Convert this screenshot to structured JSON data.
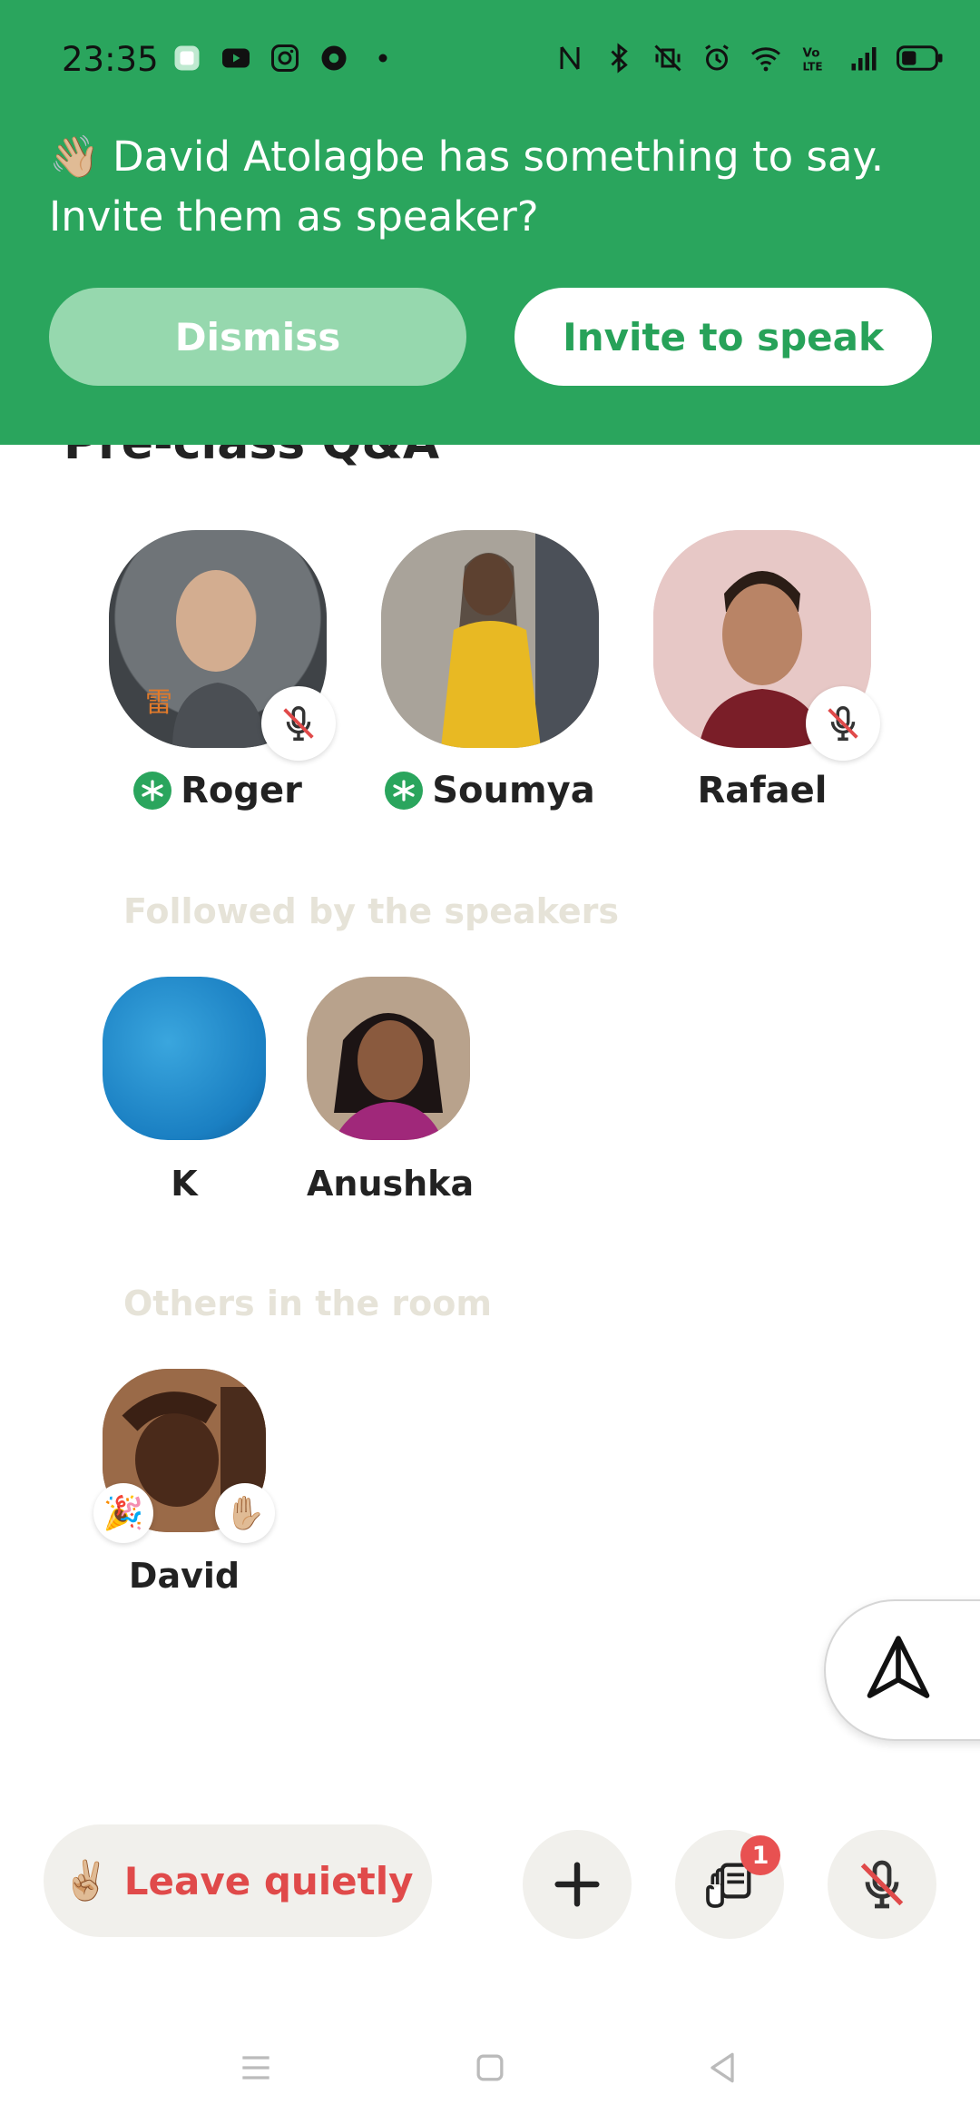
{
  "status_bar": {
    "time": "23:35",
    "left_icons": [
      "app-icon",
      "youtube-icon",
      "instagram-icon",
      "chrome-icon",
      "dot-icon"
    ],
    "right_icons": [
      "nfc-icon",
      "bluetooth-icon",
      "vibrate-off-icon",
      "alarm-icon",
      "wifi-icon",
      "volte-icon",
      "signal-icon",
      "battery-icon"
    ]
  },
  "banner": {
    "emoji": "👋🏼",
    "message": "David Atolagbe has something to say. Invite them as speaker?",
    "dismiss_label": "Dismiss",
    "invite_label": "Invite to speak",
    "color": "#2aa55d"
  },
  "room": {
    "title": "Pre-class Q&A"
  },
  "speakers": [
    {
      "name": "Roger",
      "moderator": true,
      "muted": true
    },
    {
      "name": "Soumya",
      "moderator": true,
      "muted": false
    },
    {
      "name": "Rafael",
      "moderator": false,
      "muted": true
    }
  ],
  "sections": {
    "followed_label": "Followed by the speakers",
    "others_label": "Others in the room"
  },
  "followed": [
    {
      "name": "K"
    },
    {
      "name": "Anushka"
    }
  ],
  "others": [
    {
      "name": "David",
      "badge_left": "🎉",
      "badge_right": "✋🏼"
    }
  ],
  "bottom_bar": {
    "leave_emoji": "✌🏼",
    "leave_label": "Leave quietly",
    "hand_badge_count": "1",
    "accent_red": "#e04a4a"
  }
}
